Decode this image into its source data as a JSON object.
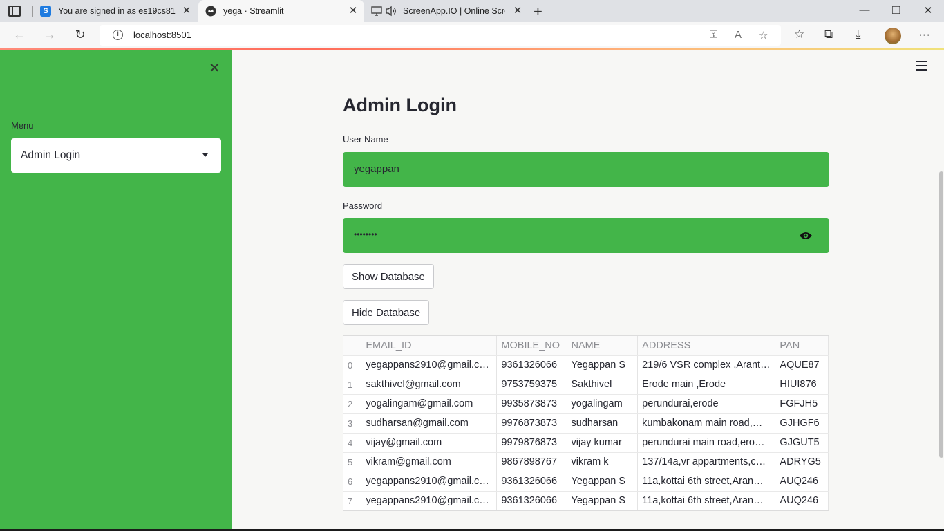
{
  "browser": {
    "tabs": [
      {
        "title": "You are signed in as es19cs81",
        "favicon": "S",
        "favicon_color": "#1e7be0",
        "active": false
      },
      {
        "title": "yega · Streamlit",
        "favicon": "streamlit-crown",
        "favicon_color": "#333333",
        "active": true
      },
      {
        "title": "ScreenApp.IO | Online Scree",
        "favicon": "monitor-speaker",
        "favicon_color": "#555555",
        "active": false
      }
    ],
    "url": "localhost:8501"
  },
  "sidebar": {
    "background": "#43b549",
    "menu_label": "Menu",
    "select_value": "Admin Login"
  },
  "main": {
    "title": "Admin Login",
    "username_label": "User Name",
    "username_value": "yegappan",
    "password_label": "Password",
    "password_mask": "••••••••",
    "show_button": "Show Database",
    "hide_button": "Hide Database"
  },
  "table": {
    "columns": [
      "",
      "EMAIL_ID",
      "MOBILE_NO",
      "NAME",
      "ADDRESS",
      "PAN"
    ],
    "rows": [
      [
        "0",
        "yegappans2910@gmail.c…",
        "9361326066",
        "Yegappan S",
        "219/6 VSR complex ,Arant…",
        "AQUE87"
      ],
      [
        "1",
        "sakthivel@gmail.com",
        "9753759375",
        "Sakthivel",
        "Erode main ,Erode",
        "HIUI876"
      ],
      [
        "2",
        "yogalingam@gmail.com",
        "9935873873",
        "yogalingam",
        "perundurai,erode",
        "FGFJH5"
      ],
      [
        "3",
        "sudharsan@gmail.com",
        "9976873873",
        "sudharsan",
        "kumbakonam main road,…",
        "GJHGF6"
      ],
      [
        "4",
        "vijay@gmail.com",
        "9979876873",
        "vijay kumar",
        "perundurai main road,ero…",
        "GJGUT5"
      ],
      [
        "5",
        "vikram@gmail.com",
        "9867898767",
        "vikram k",
        "137/14a,vr appartments,c…",
        "ADRYG5"
      ],
      [
        "6",
        "yegappans2910@gmail.c…",
        "9361326066",
        "Yegappan S",
        "11a,kottai 6th street,Aran…",
        "AUQ246"
      ],
      [
        "7",
        "yegappans2910@gmail.c…",
        "9361326066",
        "Yegappan S",
        "11a,kottai 6th street,Aran…",
        "AUQ246"
      ]
    ]
  }
}
